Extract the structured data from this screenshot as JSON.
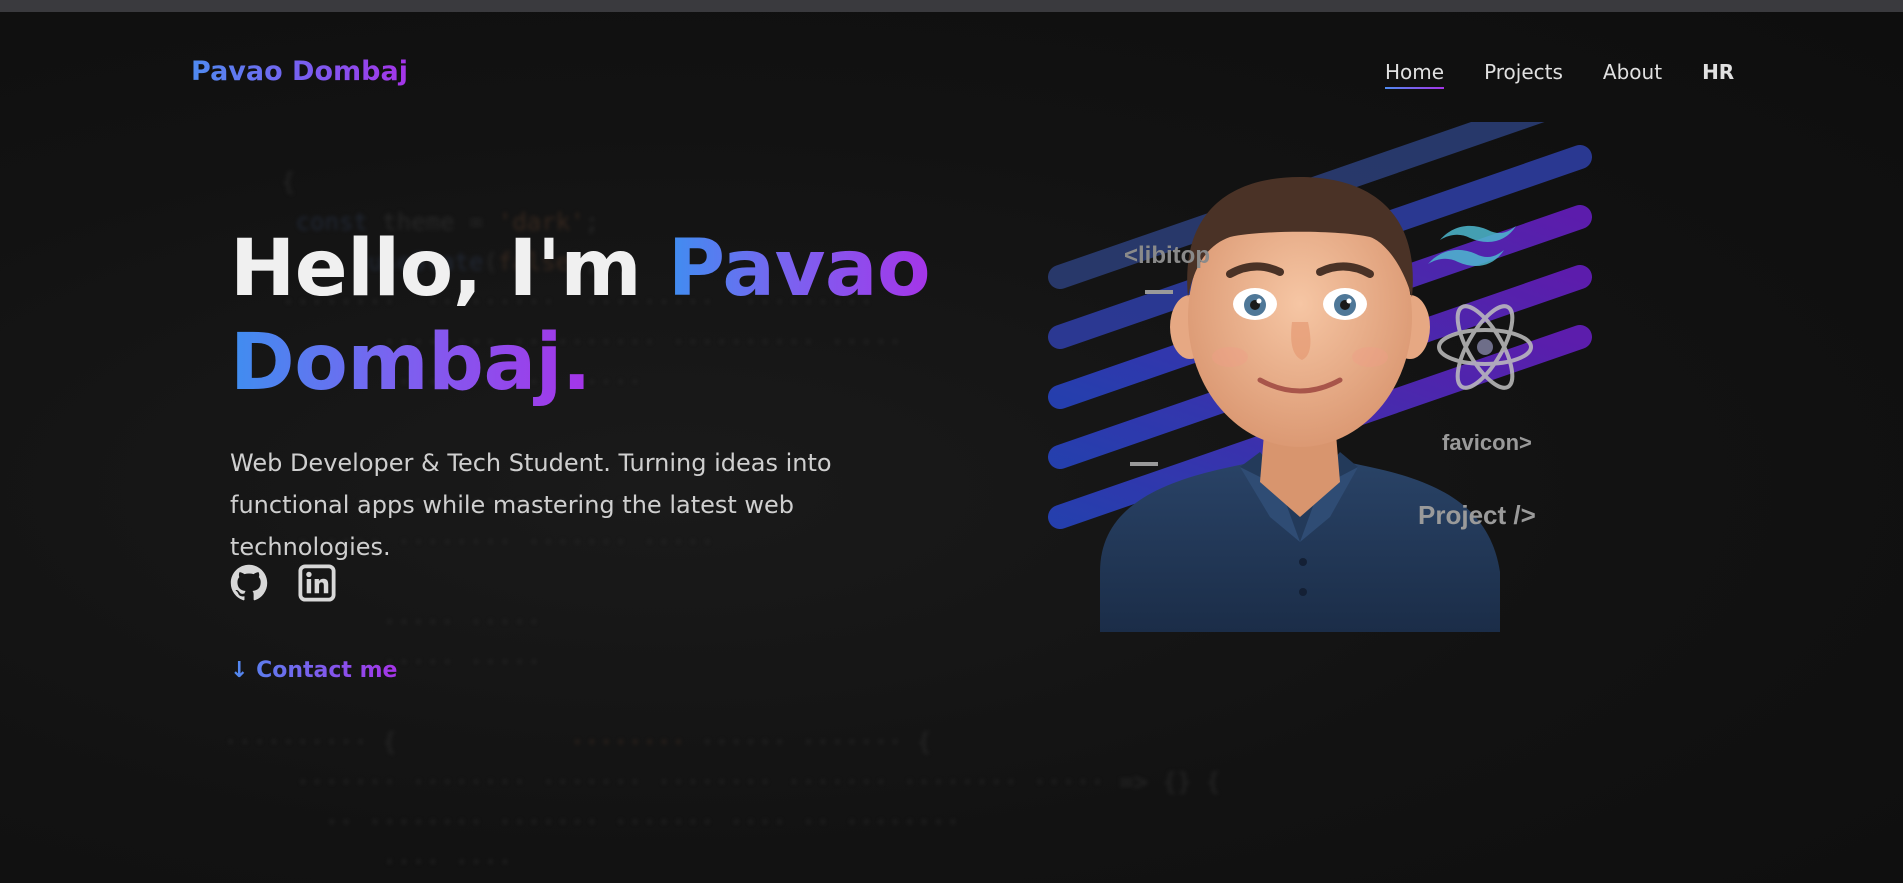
{
  "brand": {
    "name": "Pavao Dombaj"
  },
  "nav": {
    "items": [
      {
        "label": "Home",
        "active": true
      },
      {
        "label": "Projects",
        "active": false
      },
      {
        "label": "About",
        "active": false
      },
      {
        "label": "HR",
        "active": false
      }
    ]
  },
  "hero": {
    "greeting": "Hello, I'm ",
    "first_name": "Pavao",
    "last_name": "Dombaj.",
    "description": "Web Developer & Tech Student. Turning ideas into functional apps while mastering the latest web technologies.",
    "socials": [
      {
        "icon": "github-icon"
      },
      {
        "icon": "linkedin-icon"
      }
    ],
    "cta_label": "↓ Contact me",
    "image_tags": {
      "libitop": "<libitop",
      "favicon": "favicon>",
      "project": "Project />"
    }
  },
  "colors": {
    "background": "#111111",
    "accent_blue": "#4f8bf0",
    "accent_purple": "#a534e8"
  }
}
